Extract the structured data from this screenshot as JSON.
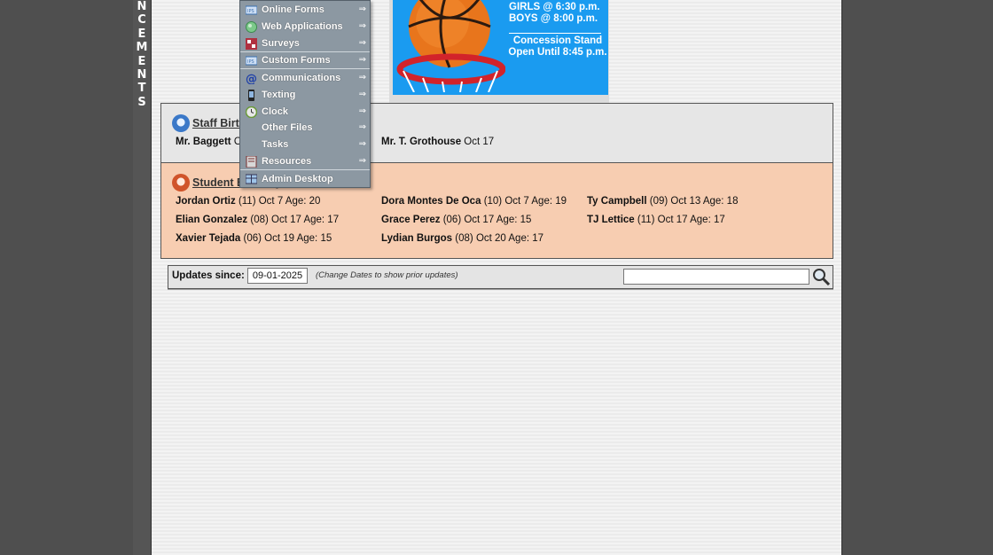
{
  "sidebar_word": [
    "N",
    "C",
    "E",
    "M",
    "E",
    "N",
    "T",
    "S"
  ],
  "banner": {
    "line1": "GIRLS @ 6:30 p.m.",
    "line2": "BOYS  @ 8:00 p.m.",
    "line3": "Concession Stand",
    "line4": "Open Until 8:45 p.m."
  },
  "menu": {
    "items": [
      {
        "label": "Online Forms",
        "icon": "form-icon"
      },
      {
        "label": "Web Applications",
        "icon": "globe-icon"
      },
      {
        "label": "Surveys",
        "icon": "survey-icon"
      },
      {
        "label": "Custom Forms",
        "icon": "form-icon"
      },
      {
        "label": "Communications",
        "icon": "at-icon"
      },
      {
        "label": "Texting",
        "icon": "phone-icon"
      },
      {
        "label": "Clock",
        "icon": "clock-icon"
      },
      {
        "label": "Other Files",
        "icon": ""
      },
      {
        "label": "Tasks",
        "icon": ""
      },
      {
        "label": "Resources",
        "icon": "book-icon"
      },
      {
        "label": "Admin Desktop",
        "icon": "desktop-icon"
      }
    ],
    "arrow": "⇒"
  },
  "staff": {
    "title": "Staff Birthdays",
    "entries": [
      {
        "name": "Mr. Baggett",
        "detail": "Oct 10"
      },
      {
        "name": "Mr. T. Grothouse",
        "detail": "Oct 17"
      }
    ]
  },
  "students": {
    "title": "Student Birthdays",
    "entries": [
      {
        "name": "Jordan Ortiz",
        "detail": "(11) Oct 7 Age: 20"
      },
      {
        "name": "Dora Montes De Oca",
        "detail": "(10) Oct 7 Age: 19"
      },
      {
        "name": "Ty Campbell",
        "detail": "(09) Oct 13 Age: 18"
      },
      {
        "name": "Elian Gonzalez",
        "detail": "(08) Oct 17 Age: 17"
      },
      {
        "name": "Grace Perez",
        "detail": "(06) Oct 17 Age: 15"
      },
      {
        "name": "TJ Lettice",
        "detail": "(11) Oct 17 Age: 17"
      },
      {
        "name": "Xavier Tejada",
        "detail": "(06) Oct 19 Age: 15"
      },
      {
        "name": "Lydian Burgos",
        "detail": "(08) Oct 20 Age: 17"
      }
    ]
  },
  "updates": {
    "label": "Updates since:",
    "date": "09-01-2025",
    "note": "(Change Dates to show prior updates)",
    "search_value": ""
  }
}
